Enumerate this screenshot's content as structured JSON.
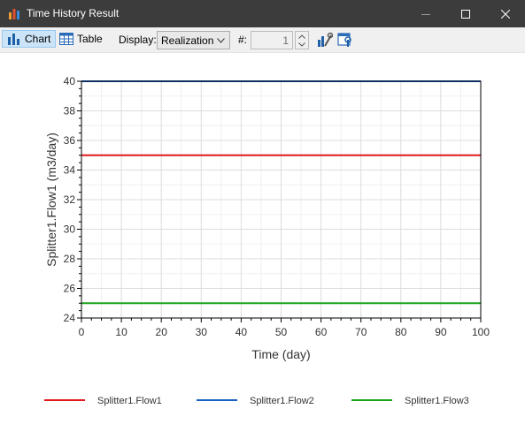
{
  "window": {
    "title": "Time History Result",
    "icon": "bar-chart-icon"
  },
  "toolbar": {
    "chart_label": "Chart",
    "table_label": "Table",
    "display_label": "Display:",
    "display_value": "Realization",
    "number_label": "#:",
    "number_value": "1"
  },
  "colors": {
    "flow1": "#e0191c",
    "flow2": "#1761c4",
    "flow3": "#1aa31a"
  },
  "chart_data": {
    "type": "line",
    "xlabel": "Time (day)",
    "ylabel": "Splitter1.Flow1 (m3/day)",
    "xlim": [
      0,
      100
    ],
    "ylim": [
      24,
      40
    ],
    "xticks": [
      0,
      10,
      20,
      30,
      40,
      50,
      60,
      70,
      80,
      90,
      100
    ],
    "yticks": [
      24,
      26,
      28,
      30,
      32,
      34,
      36,
      38,
      40
    ],
    "grid": true,
    "legend_position": "bottom",
    "series": [
      {
        "name": "Splitter1.Flow1",
        "color": "#e0191c",
        "x": [
          0,
          100
        ],
        "y": [
          35,
          35
        ]
      },
      {
        "name": "Splitter1.Flow2",
        "color": "#1761c4",
        "x": [
          0,
          100
        ],
        "y": [
          40,
          40
        ]
      },
      {
        "name": "Splitter1.Flow3",
        "color": "#1aa31a",
        "x": [
          0,
          100
        ],
        "y": [
          25,
          25
        ]
      }
    ]
  }
}
